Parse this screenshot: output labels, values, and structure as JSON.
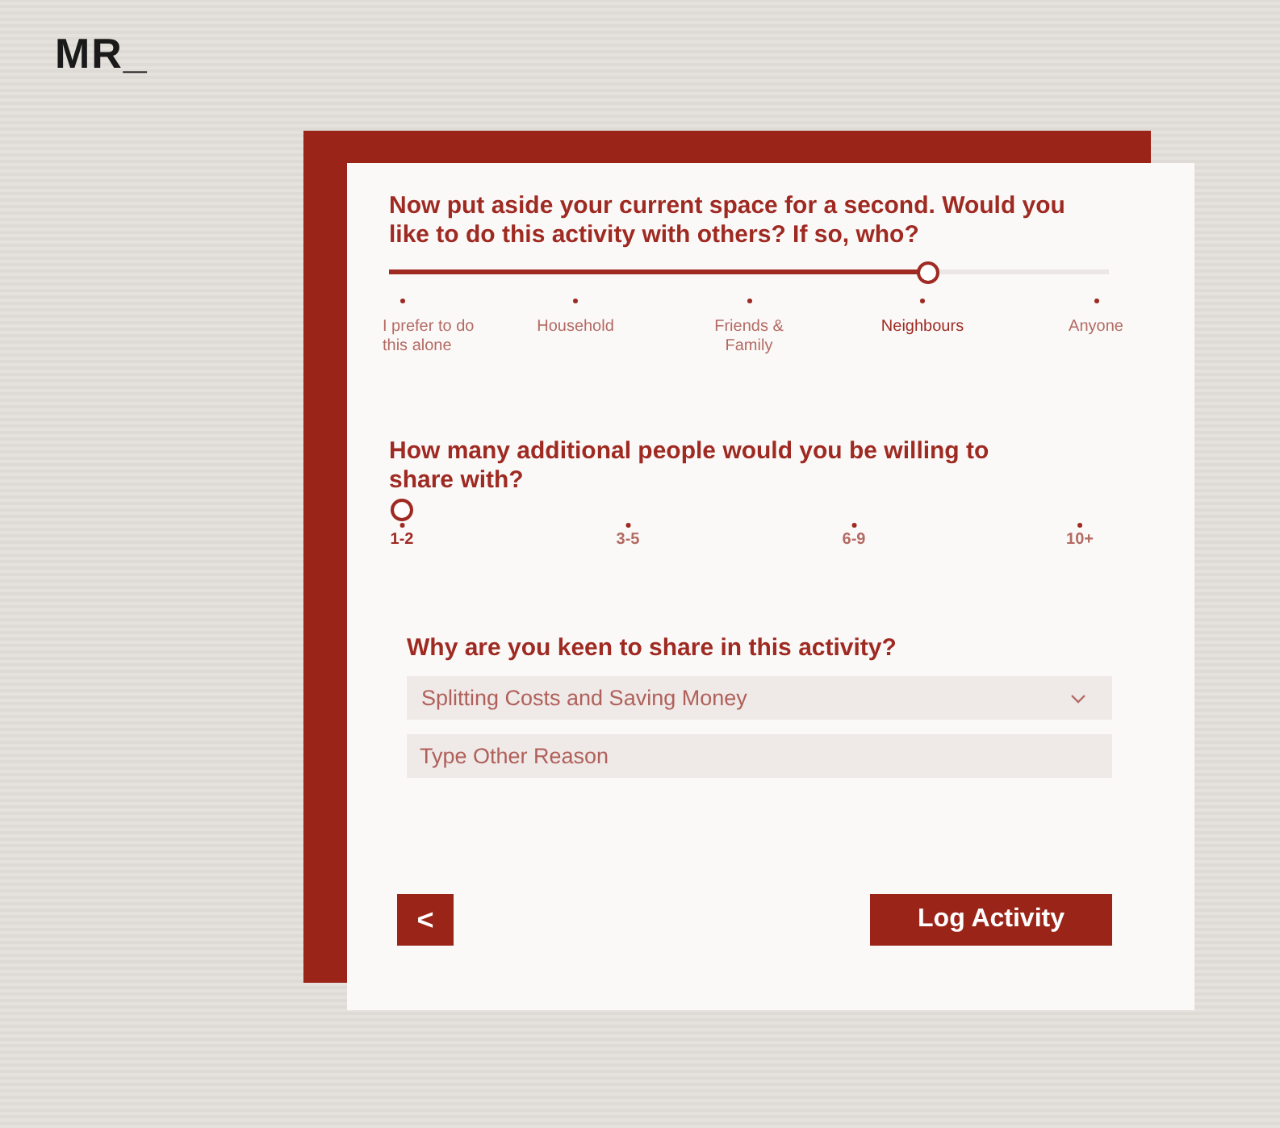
{
  "logo": "MR_",
  "companion_question": {
    "question": "Now put aside your current space for a second. Would you like to do this activity with others? If so, who?",
    "level": 0.75,
    "options": [
      {
        "label": "I prefer to do this alone",
        "selected": false
      },
      {
        "label": "Household",
        "selected": false
      },
      {
        "label": "Friends & Family",
        "selected": false
      },
      {
        "label": "Neighbours",
        "selected": true
      },
      {
        "label": "Anyone",
        "selected": false
      }
    ]
  },
  "people_question": {
    "question": "How many additional people would you be willing to share with?",
    "level": 0,
    "options": [
      {
        "label": "1-2",
        "selected": true
      },
      {
        "label": "3-5",
        "selected": false
      },
      {
        "label": "6-9",
        "selected": false
      },
      {
        "label": "10+",
        "selected": false
      }
    ]
  },
  "reason": {
    "question": "Why are you keen to share in this activity?",
    "dropdown_value": "Splitting Costs and Saving Money",
    "other_placeholder": "Type Other Reason"
  },
  "buttons": {
    "back": "<",
    "submit": "Log Activity"
  }
}
